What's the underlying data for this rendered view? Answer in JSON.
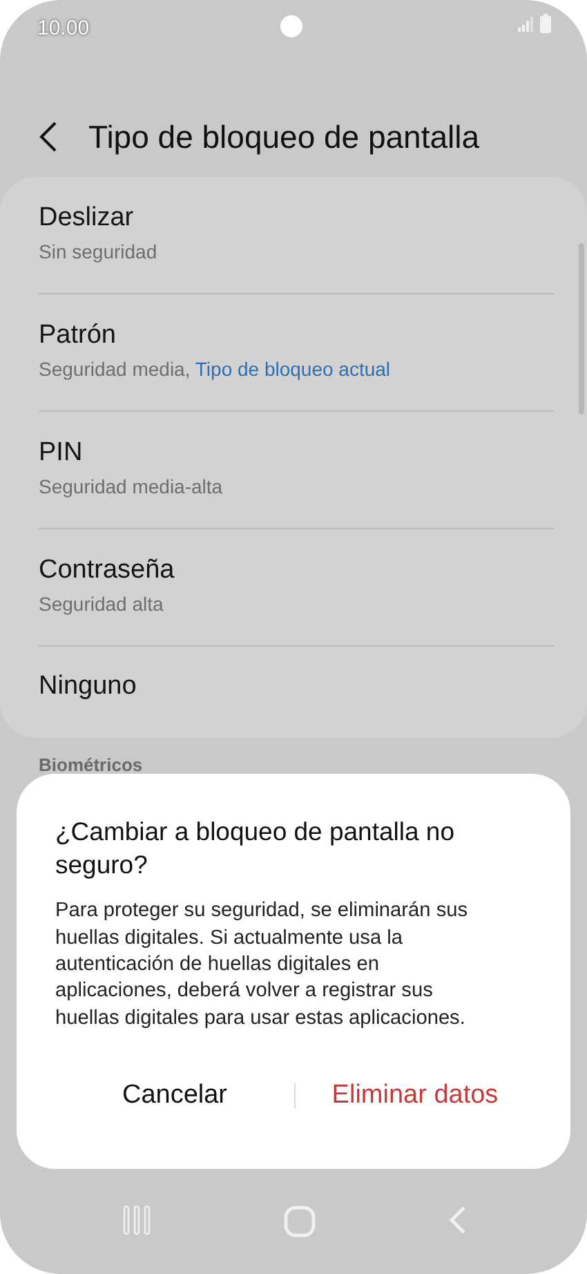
{
  "status_bar": {
    "time": "10.00"
  },
  "header": {
    "title": "Tipo de bloqueo de pantalla"
  },
  "options": [
    {
      "title": "Deslizar",
      "subtitle": "Sin seguridad"
    },
    {
      "title": "Patrón",
      "subtitle": "Seguridad media,",
      "current_label": "Tipo de bloqueo actual"
    },
    {
      "title": "PIN",
      "subtitle": "Seguridad media-alta"
    },
    {
      "title": "Contraseña",
      "subtitle": "Seguridad alta"
    },
    {
      "title": "Ninguno"
    }
  ],
  "section_header": "Biométricos",
  "dialog": {
    "title": "¿Cambiar a bloqueo de pantalla no seguro?",
    "message": "Para proteger su seguridad, se eliminarán sus huellas digitales. Si actualmente usa la autenticación de huellas digitales en aplicaciones, deberá volver a registrar sus huellas digitales para usar estas aplicaciones.",
    "buttons": [
      {
        "label": "Cancelar",
        "kind": "neutral"
      },
      {
        "label": "Eliminar datos",
        "kind": "destructive"
      }
    ]
  }
}
